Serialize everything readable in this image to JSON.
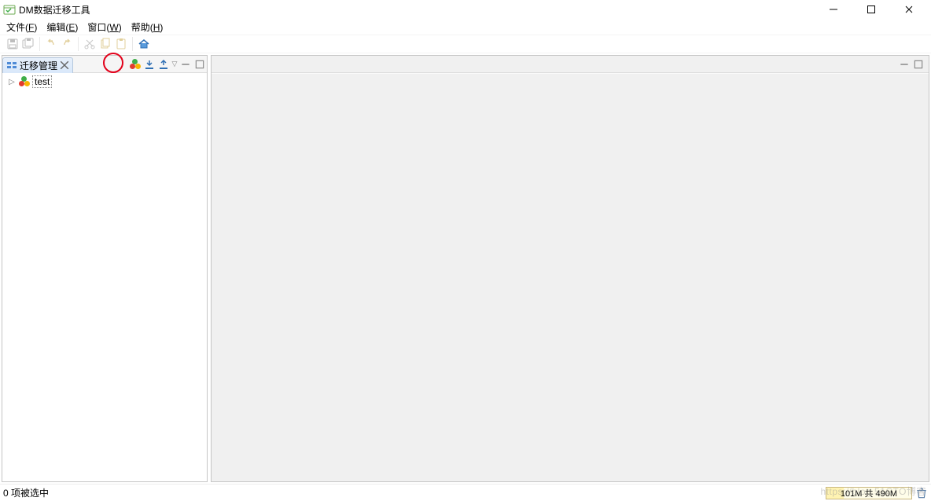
{
  "title_bar": {
    "title": "DM数据迁移工具"
  },
  "window_controls": {
    "minimize": "—",
    "maximize": "□",
    "close": "✕"
  },
  "menu": {
    "file": {
      "label": "文件",
      "mnemonic": "F"
    },
    "edit": {
      "label": "编辑",
      "mnemonic": "E"
    },
    "window": {
      "label": "窗口",
      "mnemonic": "W"
    },
    "help": {
      "label": "帮助",
      "mnemonic": "H"
    }
  },
  "left_panel": {
    "tab_label": "迁移管理",
    "tree_items": [
      {
        "label": "test"
      }
    ]
  },
  "status_bar": {
    "left_text": "0 项被选中",
    "memory_text": "101M 共 490M"
  },
  "watermark": "https://blog.51CTO博客"
}
